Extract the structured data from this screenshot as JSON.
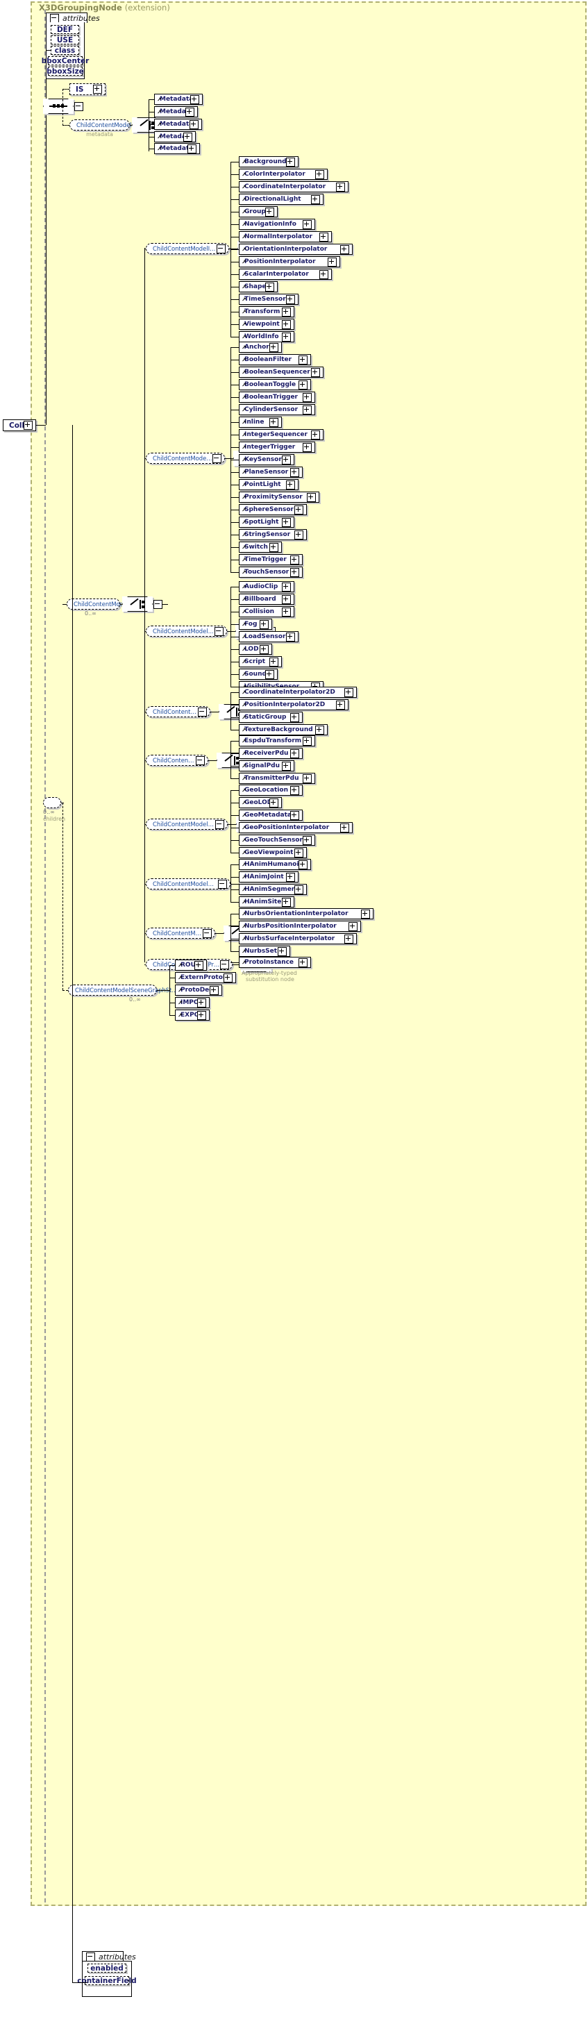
{
  "diagram": {
    "root_element": "Collision",
    "extension_title": "X3DGroupingNode",
    "extension_suffix": "(extension)",
    "attributes_label": "attributes",
    "top_attributes": [
      "DEF",
      "USE",
      "class",
      "bboxCenter",
      "bboxSize"
    ],
    "bottom_attributes": [
      "enabled",
      "containerField"
    ],
    "is_element": "IS",
    "core_group": {
      "label": "ChildContentModelCore",
      "caption": "metadata",
      "children": [
        "MetadataDouble",
        "MetadataFloat",
        "MetadataInteger",
        "MetadataSet",
        "MetadataString"
      ]
    },
    "child_content_model": {
      "label": "ChildContentModel",
      "occurs": "0..∞"
    },
    "children_occurs": "0..∞",
    "children_caption": "children",
    "groups": [
      {
        "label": "ChildContentModelInterchange",
        "children": [
          "Background",
          "ColorInterpolator",
          "CoordinateInterpolator",
          "DirectionalLight",
          "Group",
          "NavigationInfo",
          "NormalInterpolator",
          "OrientationInterpolator",
          "PositionInterpolator",
          "ScalarInterpolator",
          "Shape",
          "TimeSensor",
          "Transform",
          "Viewpoint",
          "WorldInfo"
        ]
      },
      {
        "label": "ChildContentModelInteractive",
        "children": [
          "Anchor",
          "BooleanFilter",
          "BooleanSequencer",
          "BooleanToggle",
          "BooleanTrigger",
          "CylinderSensor",
          "Inline",
          "IntegerSequencer",
          "IntegerTrigger",
          "KeySensor",
          "PlaneSensor",
          "PointLight",
          "ProximitySensor",
          "SphereSensor",
          "SpotLight",
          "StringSensor",
          "Switch",
          "TimeTrigger",
          "TouchSensor"
        ]
      },
      {
        "label": "ChildContentModelImmersive",
        "children": [
          "AudioClip",
          "Billboard",
          "Collision",
          "Fog",
          "LoadSensor",
          "LOD",
          "Script",
          "Sound",
          "VisibilitySensor"
        ]
      },
      {
        "label": "ChildContentModelFull",
        "children": [
          "CoordinateInterpolator2D",
          "PositionInterpolator2D",
          "StaticGroup",
          "TextureBackground"
        ]
      },
      {
        "label": "ChildContentModelDIS",
        "children": [
          "EspduTransform",
          "ReceiverPdu",
          "SignalPdu",
          "TransmitterPdu"
        ]
      },
      {
        "label": "ChildContentModelGeoSpatial",
        "children": [
          "GeoLocation",
          "GeoLOD",
          "GeoMetadata",
          "GeoPositionInterpolator",
          "GeoTouchSensor",
          "GeoViewpoint"
        ]
      },
      {
        "label": "ChildContentModelHumanoidAn...",
        "children": [
          "HAnimHumanoid",
          "HAnimJoint",
          "HAnimSegment",
          "HAnimSite"
        ]
      },
      {
        "label": "ChildContentModelNurbs",
        "children": [
          "NurbsOrientationInterpolator",
          "NurbsPositionInterpolator",
          "NurbsSurfaceInterpolator",
          "NurbsSet"
        ]
      },
      {
        "label": "ChildContentModelProtoInstance",
        "children": [
          "ProtoInstance"
        ],
        "caption": "Appropriately-typed\nsubstitution node"
      },
      {
        "label": "ChildContentModelSceneGraphSt...",
        "occurs": "0..∞",
        "children": [
          "ROUTE",
          "ExternProtoDeclare",
          "ProtoDeclare",
          "IMPORT",
          "EXPORT"
        ]
      }
    ],
    "proto_caption_line1": "Appropriately-typed",
    "proto_caption_line2": "substitution node",
    "colors": {
      "background": "#ffffcc",
      "element_text": "#1a1a66",
      "group_text": "#1a4a9a",
      "title": "#888855",
      "caption": "#9a9a7a"
    }
  }
}
